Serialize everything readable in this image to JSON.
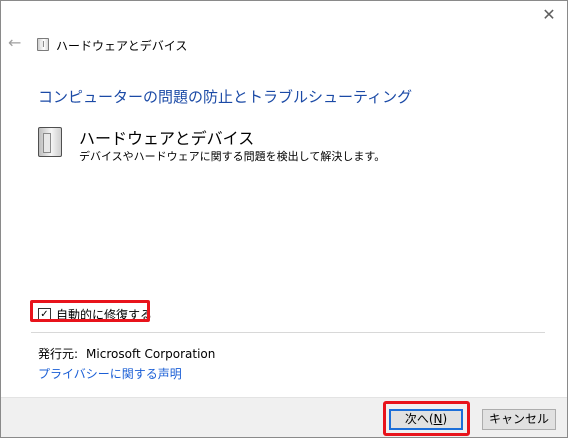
{
  "window": {
    "title": "ハードウェアとデバイス",
    "close_icon": "close-icon",
    "back_icon": "back-arrow-icon"
  },
  "main": {
    "heading": "コンピューターの問題の防止とトラブルシューティング",
    "item": {
      "title": "ハードウェアとデバイス",
      "description": "デバイスやハードウェアに関する問題を検出して解決します。",
      "icon": "hardware-device-icon"
    },
    "auto_repair": {
      "label": "自動的に修復する",
      "checked": true
    },
    "publisher": {
      "label": "発行元:",
      "value": "Microsoft Corporation"
    },
    "privacy_link": "プライバシーに関する声明"
  },
  "footer": {
    "next_label_prefix": "次へ(",
    "next_label_key": "N",
    "next_label_suffix": ")",
    "cancel_label": "キャンセル"
  },
  "colors": {
    "heading": "#1b4aa6",
    "link": "#1b5fd6",
    "highlight": "#e8131b",
    "footer_bg": "#f0f0f0"
  }
}
